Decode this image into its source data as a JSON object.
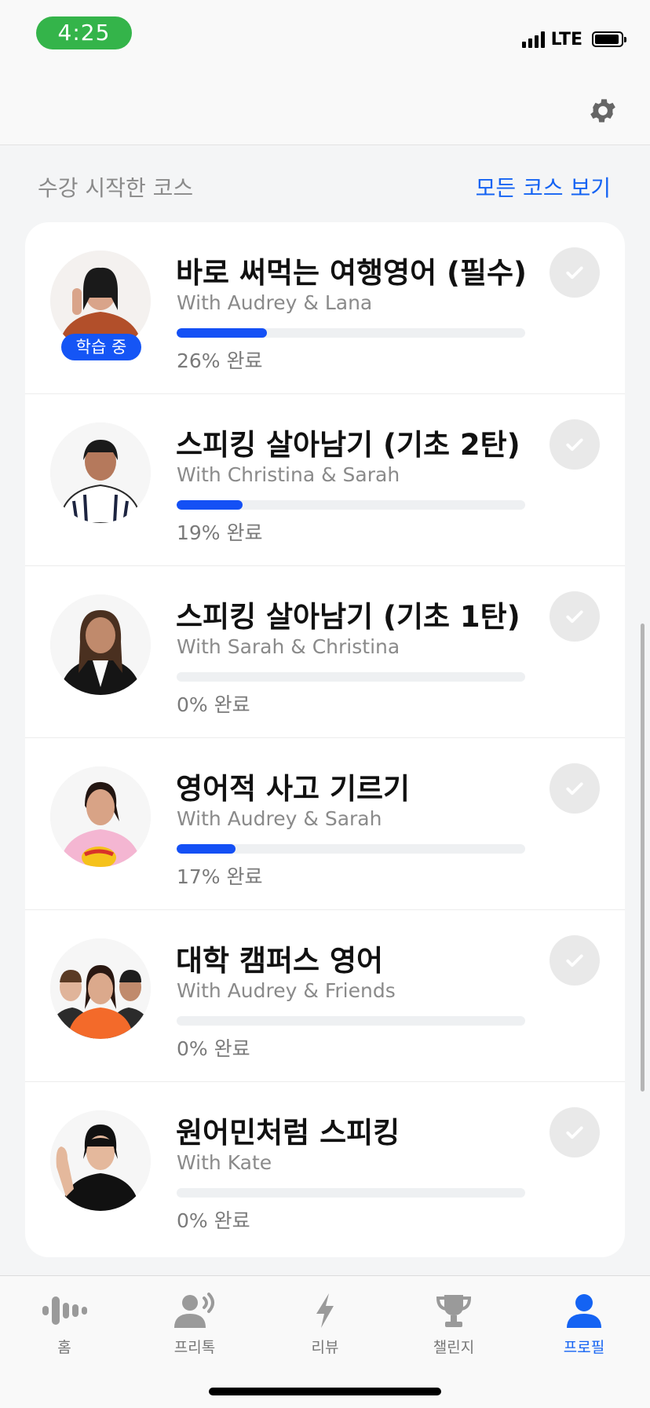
{
  "status_bar": {
    "time": "4:25",
    "network": "LTE"
  },
  "header": {
    "settings_icon": "gear-icon"
  },
  "section": {
    "title": "수강 시작한 코스",
    "see_all": "모든 코스 보기"
  },
  "courses": [
    {
      "title": "바로 써먹는 여행영어 (필수)",
      "instructors": "With Audrey & Lana",
      "progress_percent": 26,
      "progress_text": "26% 완료",
      "badge": "학습 중"
    },
    {
      "title": "스피킹 살아남기 (기초 2탄)",
      "instructors": "With Christina & Sarah",
      "progress_percent": 19,
      "progress_text": "19% 완료"
    },
    {
      "title": "스피킹 살아남기 (기초 1탄)",
      "instructors": "With Sarah & Christina",
      "progress_percent": 0,
      "progress_text": "0% 완료"
    },
    {
      "title": "영어적 사고 기르기",
      "instructors": "With Audrey & Sarah",
      "progress_percent": 17,
      "progress_text": "17% 완료"
    },
    {
      "title": "대학 캠퍼스 영어",
      "instructors": "With Audrey & Friends",
      "progress_percent": 0,
      "progress_text": "0% 완료"
    },
    {
      "title": "원어민처럼 스피킹",
      "instructors": "With Kate",
      "progress_percent": 0,
      "progress_text": "0% 완료"
    }
  ],
  "nav": {
    "items": [
      {
        "label": "홈",
        "icon": "soundwave-icon"
      },
      {
        "label": "프리톡",
        "icon": "speaking-person-icon"
      },
      {
        "label": "리뷰",
        "icon": "lightning-icon"
      },
      {
        "label": "챌린지",
        "icon": "trophy-icon"
      },
      {
        "label": "프로필",
        "icon": "person-icon"
      }
    ],
    "active_index": 4
  },
  "colors": {
    "accent": "#1463f3",
    "progress": "#1450f5",
    "time_pill": "#34b44a"
  }
}
